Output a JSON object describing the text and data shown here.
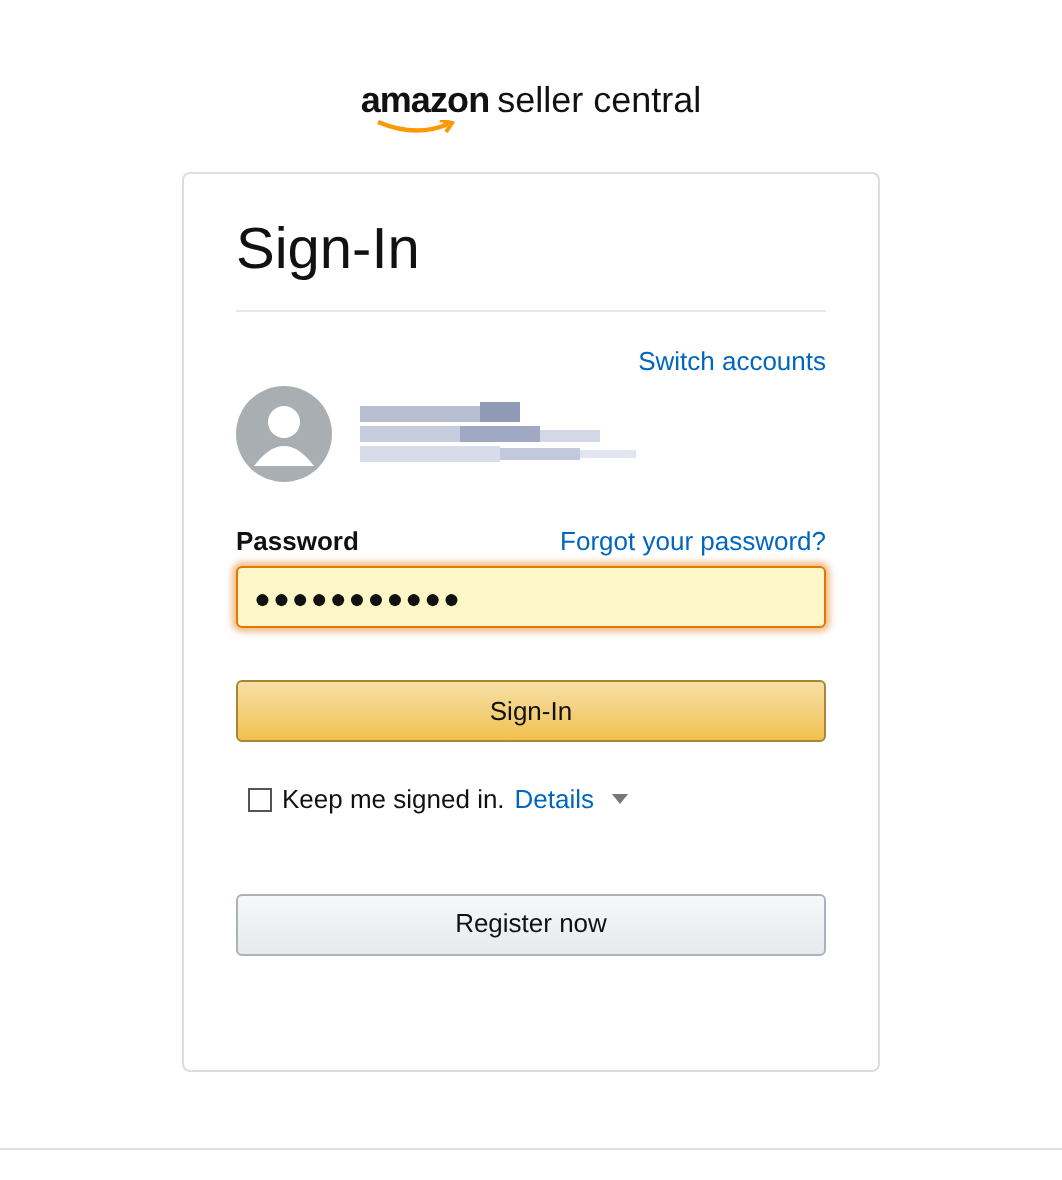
{
  "logo": {
    "brand": "amazon",
    "product": "seller central"
  },
  "card": {
    "title": "Sign-In",
    "switch_link": "Switch accounts",
    "password": {
      "label": "Password",
      "forgot_link": "Forgot your password?",
      "value": "●●●●●●●●●●●",
      "focused": true
    },
    "sign_in_button": "Sign-In",
    "keep_signed_in": {
      "label": "Keep me signed in.",
      "checked": false,
      "details_link": "Details"
    },
    "register_button": "Register now"
  }
}
